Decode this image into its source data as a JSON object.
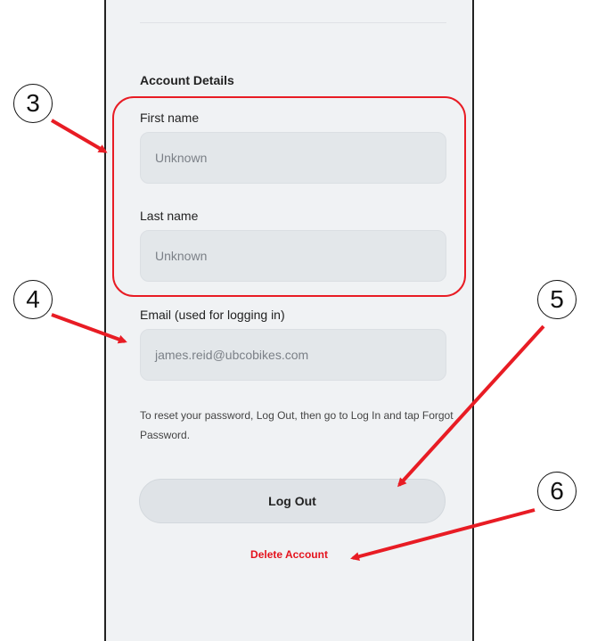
{
  "account": {
    "section_title": "Account Details",
    "first_name_label": "First name",
    "first_name_value": "Unknown",
    "last_name_label": "Last name",
    "last_name_value": "Unknown",
    "email_label": "Email (used for logging in)",
    "email_value": "james.reid@ubcobikes.com",
    "help_text": "To reset your password, Log Out, then go to Log In and tap Forgot Password.",
    "logout_label": "Log Out",
    "delete_label": "Delete Account"
  },
  "annotations": {
    "callout_3": "3",
    "callout_4": "4",
    "callout_5": "5",
    "callout_6": "6",
    "accent_color": "#e81c24"
  }
}
